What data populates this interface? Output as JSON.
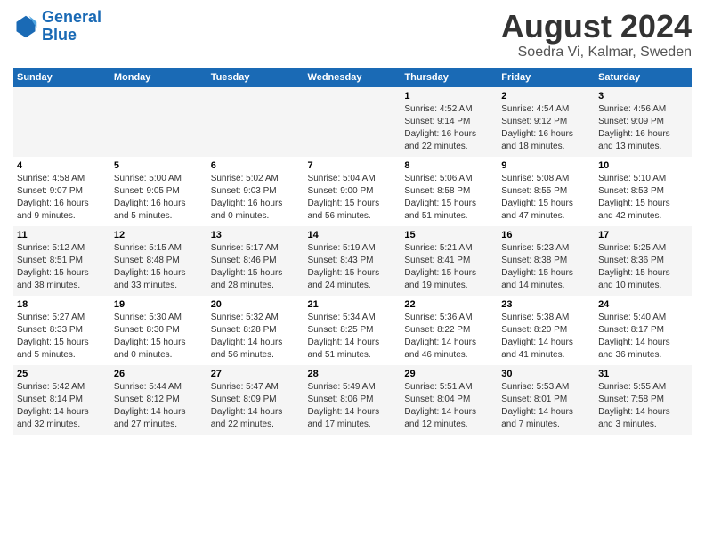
{
  "logo": {
    "text1": "General",
    "text2": "Blue"
  },
  "title": "August 2024",
  "subtitle": "Soedra Vi, Kalmar, Sweden",
  "weekdays": [
    "Sunday",
    "Monday",
    "Tuesday",
    "Wednesday",
    "Thursday",
    "Friday",
    "Saturday"
  ],
  "weeks": [
    [
      {
        "day": "",
        "info": ""
      },
      {
        "day": "",
        "info": ""
      },
      {
        "day": "",
        "info": ""
      },
      {
        "day": "",
        "info": ""
      },
      {
        "day": "1",
        "info": "Sunrise: 4:52 AM\nSunset: 9:14 PM\nDaylight: 16 hours\nand 22 minutes."
      },
      {
        "day": "2",
        "info": "Sunrise: 4:54 AM\nSunset: 9:12 PM\nDaylight: 16 hours\nand 18 minutes."
      },
      {
        "day": "3",
        "info": "Sunrise: 4:56 AM\nSunset: 9:09 PM\nDaylight: 16 hours\nand 13 minutes."
      }
    ],
    [
      {
        "day": "4",
        "info": "Sunrise: 4:58 AM\nSunset: 9:07 PM\nDaylight: 16 hours\nand 9 minutes."
      },
      {
        "day": "5",
        "info": "Sunrise: 5:00 AM\nSunset: 9:05 PM\nDaylight: 16 hours\nand 5 minutes."
      },
      {
        "day": "6",
        "info": "Sunrise: 5:02 AM\nSunset: 9:03 PM\nDaylight: 16 hours\nand 0 minutes."
      },
      {
        "day": "7",
        "info": "Sunrise: 5:04 AM\nSunset: 9:00 PM\nDaylight: 15 hours\nand 56 minutes."
      },
      {
        "day": "8",
        "info": "Sunrise: 5:06 AM\nSunset: 8:58 PM\nDaylight: 15 hours\nand 51 minutes."
      },
      {
        "day": "9",
        "info": "Sunrise: 5:08 AM\nSunset: 8:55 PM\nDaylight: 15 hours\nand 47 minutes."
      },
      {
        "day": "10",
        "info": "Sunrise: 5:10 AM\nSunset: 8:53 PM\nDaylight: 15 hours\nand 42 minutes."
      }
    ],
    [
      {
        "day": "11",
        "info": "Sunrise: 5:12 AM\nSunset: 8:51 PM\nDaylight: 15 hours\nand 38 minutes."
      },
      {
        "day": "12",
        "info": "Sunrise: 5:15 AM\nSunset: 8:48 PM\nDaylight: 15 hours\nand 33 minutes."
      },
      {
        "day": "13",
        "info": "Sunrise: 5:17 AM\nSunset: 8:46 PM\nDaylight: 15 hours\nand 28 minutes."
      },
      {
        "day": "14",
        "info": "Sunrise: 5:19 AM\nSunset: 8:43 PM\nDaylight: 15 hours\nand 24 minutes."
      },
      {
        "day": "15",
        "info": "Sunrise: 5:21 AM\nSunset: 8:41 PM\nDaylight: 15 hours\nand 19 minutes."
      },
      {
        "day": "16",
        "info": "Sunrise: 5:23 AM\nSunset: 8:38 PM\nDaylight: 15 hours\nand 14 minutes."
      },
      {
        "day": "17",
        "info": "Sunrise: 5:25 AM\nSunset: 8:36 PM\nDaylight: 15 hours\nand 10 minutes."
      }
    ],
    [
      {
        "day": "18",
        "info": "Sunrise: 5:27 AM\nSunset: 8:33 PM\nDaylight: 15 hours\nand 5 minutes."
      },
      {
        "day": "19",
        "info": "Sunrise: 5:30 AM\nSunset: 8:30 PM\nDaylight: 15 hours\nand 0 minutes."
      },
      {
        "day": "20",
        "info": "Sunrise: 5:32 AM\nSunset: 8:28 PM\nDaylight: 14 hours\nand 56 minutes."
      },
      {
        "day": "21",
        "info": "Sunrise: 5:34 AM\nSunset: 8:25 PM\nDaylight: 14 hours\nand 51 minutes."
      },
      {
        "day": "22",
        "info": "Sunrise: 5:36 AM\nSunset: 8:22 PM\nDaylight: 14 hours\nand 46 minutes."
      },
      {
        "day": "23",
        "info": "Sunrise: 5:38 AM\nSunset: 8:20 PM\nDaylight: 14 hours\nand 41 minutes."
      },
      {
        "day": "24",
        "info": "Sunrise: 5:40 AM\nSunset: 8:17 PM\nDaylight: 14 hours\nand 36 minutes."
      }
    ],
    [
      {
        "day": "25",
        "info": "Sunrise: 5:42 AM\nSunset: 8:14 PM\nDaylight: 14 hours\nand 32 minutes."
      },
      {
        "day": "26",
        "info": "Sunrise: 5:44 AM\nSunset: 8:12 PM\nDaylight: 14 hours\nand 27 minutes."
      },
      {
        "day": "27",
        "info": "Sunrise: 5:47 AM\nSunset: 8:09 PM\nDaylight: 14 hours\nand 22 minutes."
      },
      {
        "day": "28",
        "info": "Sunrise: 5:49 AM\nSunset: 8:06 PM\nDaylight: 14 hours\nand 17 minutes."
      },
      {
        "day": "29",
        "info": "Sunrise: 5:51 AM\nSunset: 8:04 PM\nDaylight: 14 hours\nand 12 minutes."
      },
      {
        "day": "30",
        "info": "Sunrise: 5:53 AM\nSunset: 8:01 PM\nDaylight: 14 hours\nand 7 minutes."
      },
      {
        "day": "31",
        "info": "Sunrise: 5:55 AM\nSunset: 7:58 PM\nDaylight: 14 hours\nand 3 minutes."
      }
    ]
  ]
}
